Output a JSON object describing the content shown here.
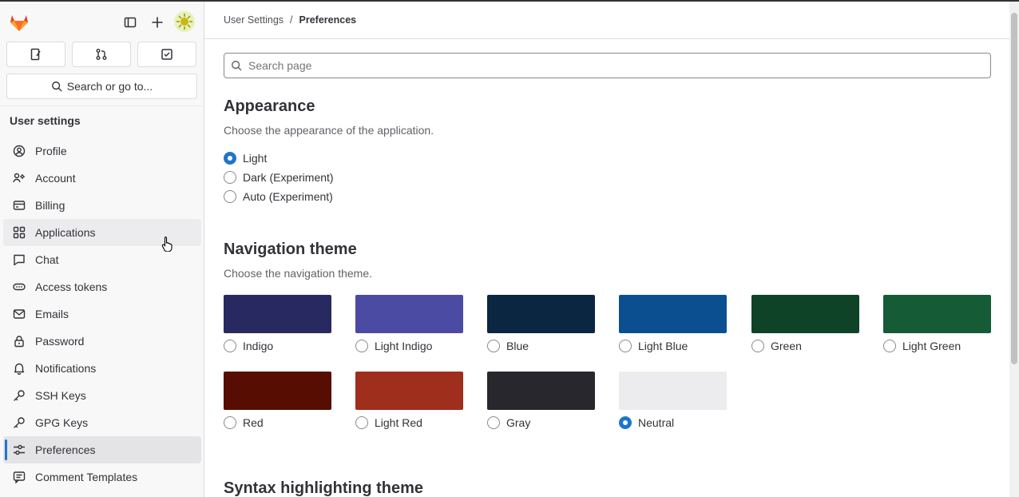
{
  "header": {
    "logo_icon": "gitlab-tanuki-icon",
    "sidebar_toggle_icon": "sidebar-toggle-icon",
    "new_icon": "plus-icon",
    "avatar_icon": "user-avatar-icon"
  },
  "shortcuts": [
    {
      "name": "issues",
      "icon": "issues-icon"
    },
    {
      "name": "merge-requests",
      "icon": "merge-request-icon"
    },
    {
      "name": "todos",
      "icon": "todo-icon"
    }
  ],
  "search": {
    "label": "Search or go to..."
  },
  "sidebar": {
    "title": "User settings",
    "items": [
      {
        "label": "Profile",
        "icon": "profile-icon"
      },
      {
        "label": "Account",
        "icon": "account-icon"
      },
      {
        "label": "Billing",
        "icon": "billing-icon"
      },
      {
        "label": "Applications",
        "icon": "applications-icon"
      },
      {
        "label": "Chat",
        "icon": "chat-icon"
      },
      {
        "label": "Access tokens",
        "icon": "token-icon"
      },
      {
        "label": "Emails",
        "icon": "mail-icon"
      },
      {
        "label": "Password",
        "icon": "lock-icon"
      },
      {
        "label": "Notifications",
        "icon": "bell-icon"
      },
      {
        "label": "SSH Keys",
        "icon": "key-icon"
      },
      {
        "label": "GPG Keys",
        "icon": "key-icon"
      },
      {
        "label": "Preferences",
        "icon": "preferences-icon"
      },
      {
        "label": "Comment Templates",
        "icon": "comment-icon"
      }
    ]
  },
  "breadcrumb": {
    "parent": "User Settings",
    "separator": "/",
    "current": "Preferences"
  },
  "page_search": {
    "placeholder": "Search page"
  },
  "appearance": {
    "title": "Appearance",
    "description": "Choose the appearance of the application.",
    "options": [
      {
        "label": "Light",
        "checked": true
      },
      {
        "label": "Dark (Experiment)",
        "checked": false
      },
      {
        "label": "Auto (Experiment)",
        "checked": false
      }
    ]
  },
  "navigation_theme": {
    "title": "Navigation theme",
    "description": "Choose the navigation theme.",
    "themes": [
      {
        "label": "Indigo",
        "color": "#292961",
        "checked": false
      },
      {
        "label": "Light Indigo",
        "color": "#4b4ba3",
        "checked": false
      },
      {
        "label": "Blue",
        "color": "#0b2640",
        "checked": false
      },
      {
        "label": "Light Blue",
        "color": "#0b4f91",
        "checked": false
      },
      {
        "label": "Green",
        "color": "#0e4328",
        "checked": false
      },
      {
        "label": "Light Green",
        "color": "#155b35",
        "checked": false
      },
      {
        "label": "Red",
        "color": "#580d02",
        "checked": false
      },
      {
        "label": "Light Red",
        "color": "#a02e1c",
        "checked": false
      },
      {
        "label": "Gray",
        "color": "#28272d",
        "checked": false
      },
      {
        "label": "Neutral",
        "color": "#ececef",
        "checked": true
      }
    ]
  },
  "syntax": {
    "title": "Syntax highlighting theme"
  }
}
